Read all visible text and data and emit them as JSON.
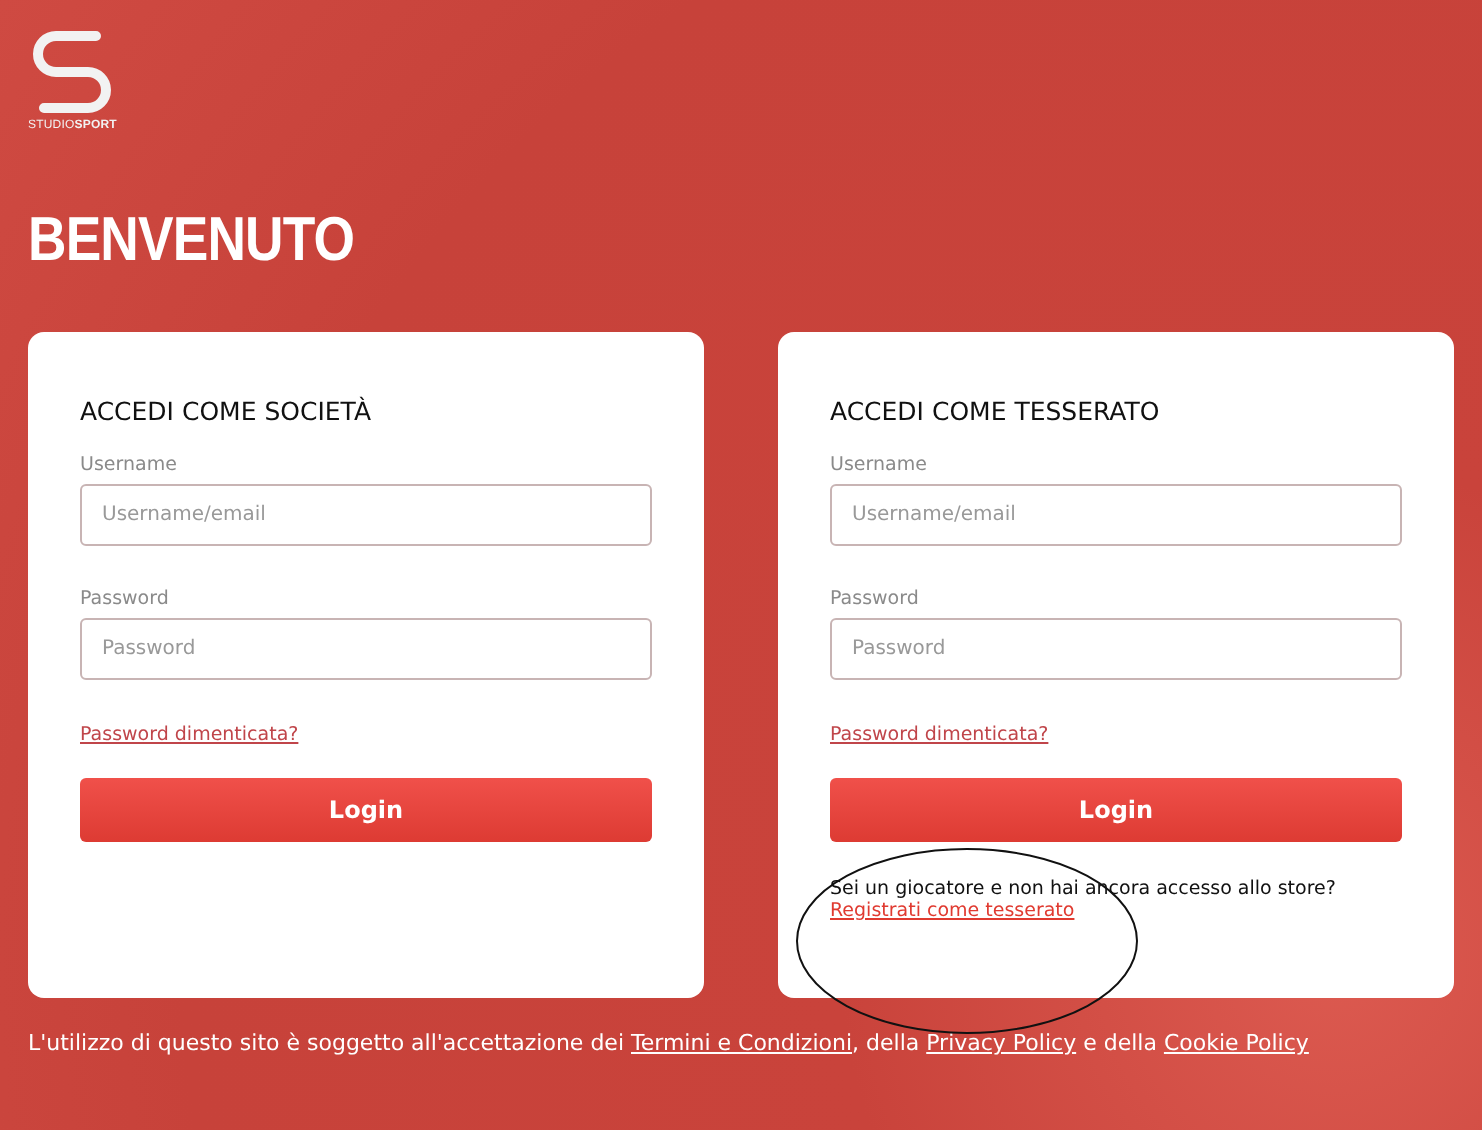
{
  "logo": {
    "text": "STUDIO**SPORT**"
  },
  "title": "BENVENUTO",
  "cards": [
    {
      "heading": "ACCEDI COME SOCIETÀ",
      "fields": [
        {
          "label": "Username",
          "placeholder": "Username/email"
        },
        {
          "label": "Password",
          "placeholder": "Password"
        }
      ],
      "forgot_link": "Password dimenticata?",
      "button": "Login"
    },
    {
      "heading": "ACCEDI COME TESSERATO",
      "fields": [
        {
          "label": "Username",
          "placeholder": "Username/email"
        },
        {
          "label": "Password",
          "placeholder": "Password"
        }
      ],
      "forgot_link": "Password dimenticata?",
      "button": "Login",
      "register_prompt": "Sei un giocatore e non hai ancora accesso allo store?",
      "register_link": "Registrati come tesserato"
    }
  ],
  "footer": [
    {
      "kind": "text",
      "text": "L'utilizzo di questo sito è soggetto all'accettazione dei "
    },
    {
      "kind": "link",
      "text": "Termini e Condizioni"
    },
    {
      "kind": "text",
      "text": ", della "
    },
    {
      "kind": "link",
      "text": "Privacy Policy"
    },
    {
      "kind": "text",
      "text": " e della "
    },
    {
      "kind": "link",
      "text": "Cookie Policy"
    }
  ]
}
